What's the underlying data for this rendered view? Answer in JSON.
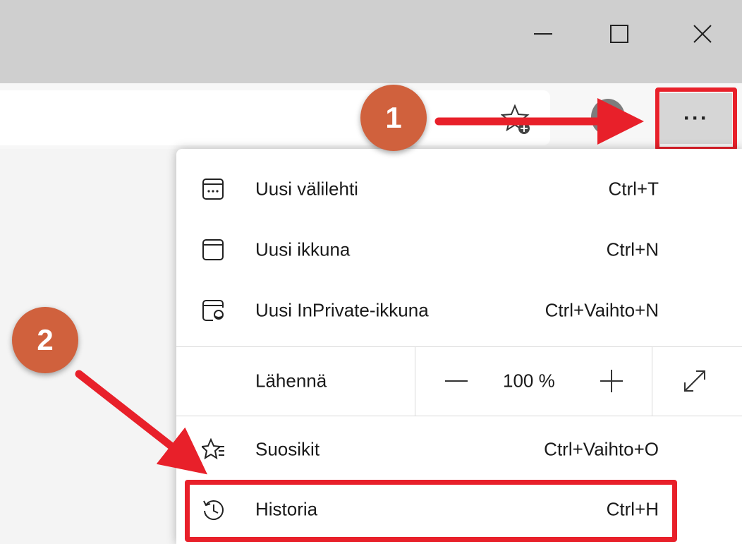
{
  "titlebar": {
    "minimize_icon": "minimize-icon",
    "maximize_icon": "maximize-icon",
    "close_icon": "close-icon"
  },
  "toolbar": {
    "favorites_add_icon": "star-add-icon",
    "profile_icon": "avatar",
    "more_label": "···"
  },
  "annotations": {
    "step1": "1",
    "step2": "2",
    "accent_color": "#e8202a",
    "badge_color": "#d0613d"
  },
  "menu": {
    "items_top": [
      {
        "label": "Uusi välilehti",
        "shortcut": "Ctrl+T",
        "icon": "new-tab-icon"
      },
      {
        "label": "Uusi ikkuna",
        "shortcut": "Ctrl+N",
        "icon": "new-window-icon"
      },
      {
        "label": "Uusi InPrivate-ikkuna",
        "shortcut": "Ctrl+Vaihto+N",
        "icon": "inprivate-icon"
      }
    ],
    "zoom": {
      "label": "Lähennä",
      "value": "100 %",
      "minus_icon": "minus-icon",
      "plus_icon": "plus-icon",
      "fullscreen_icon": "fullscreen-icon"
    },
    "items_bottom": [
      {
        "label": "Suosikit",
        "shortcut": "Ctrl+Vaihto+O",
        "icon": "favorites-icon"
      },
      {
        "label": "Historia",
        "shortcut": "Ctrl+H",
        "icon": "history-icon"
      }
    ]
  }
}
